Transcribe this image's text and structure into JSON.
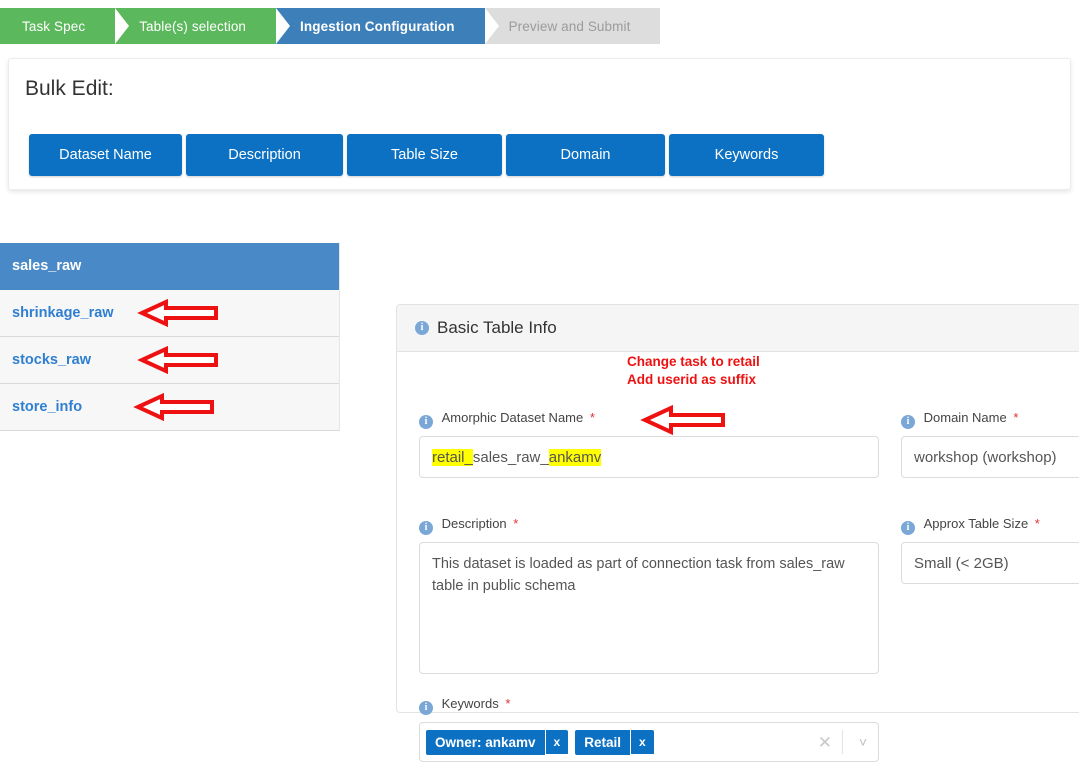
{
  "wizard": {
    "steps": [
      {
        "label": "Task Spec",
        "state": "done"
      },
      {
        "label": "Table(s) selection",
        "state": "done"
      },
      {
        "label": "Ingestion Configuration",
        "state": "active"
      },
      {
        "label": "Preview and Submit",
        "state": "todo"
      }
    ],
    "colors": {
      "done": "#5cb85c",
      "active": "#3c7fb9",
      "todo": "#dddddd",
      "todo_text": "#9b9b9b"
    }
  },
  "bulk_edit": {
    "title": "Bulk Edit:",
    "buttons": [
      "Dataset Name",
      "Description",
      "Table Size",
      "Domain",
      "Keywords"
    ],
    "button_color": "#0c71c3"
  },
  "table_list": {
    "items": [
      {
        "name": "sales_raw",
        "selected": true,
        "arrow": false
      },
      {
        "name": "shrinkage_raw",
        "selected": false,
        "arrow": true
      },
      {
        "name": "stocks_raw",
        "selected": false,
        "arrow": true
      },
      {
        "name": "store_info",
        "selected": false,
        "arrow": true
      }
    ],
    "selected_color": "#4a89c8",
    "link_color": "#2f7fd1"
  },
  "panel": {
    "header": {
      "icon": "info-icon",
      "title": "Basic Table Info"
    },
    "fields": {
      "dataset_name": {
        "label": "Amorphic Dataset Name",
        "required": "*",
        "value_prefix": "retail_",
        "value_middle": "sales_raw_",
        "value_suffix": "ankamv",
        "value_full": "retail_sales_raw_ankamv",
        "highlight_color": "#ffff00"
      },
      "domain_name": {
        "label": "Domain Name",
        "required": "*",
        "value": "workshop (workshop)"
      },
      "description": {
        "label": "Description",
        "required": "*",
        "value": "This dataset is loaded as part of connection task from sales_raw table in public schema"
      },
      "approx_table_size": {
        "label": "Approx Table Size",
        "required": "*",
        "value": "Small (< 2GB)"
      },
      "keywords": {
        "label": "Keywords",
        "required": "*",
        "chips": [
          {
            "label": "Owner: ankamv",
            "remove": "x"
          },
          {
            "label": "Retail",
            "remove": "x"
          }
        ],
        "clear_icon": "clear-icon",
        "caret_icon": "chevron-down-icon",
        "chip_color": "#0c71c3"
      }
    }
  },
  "annotations": {
    "dataset_name_note_line1": "Change task to retail",
    "dataset_name_note_line2": "Add userid as suffix",
    "color": "#ee1111",
    "arrows": [
      {
        "target": "shrinkage_raw-row"
      },
      {
        "target": "stocks_raw-row"
      },
      {
        "target": "store_info-row"
      },
      {
        "target": "dataset-name-input"
      }
    ]
  }
}
